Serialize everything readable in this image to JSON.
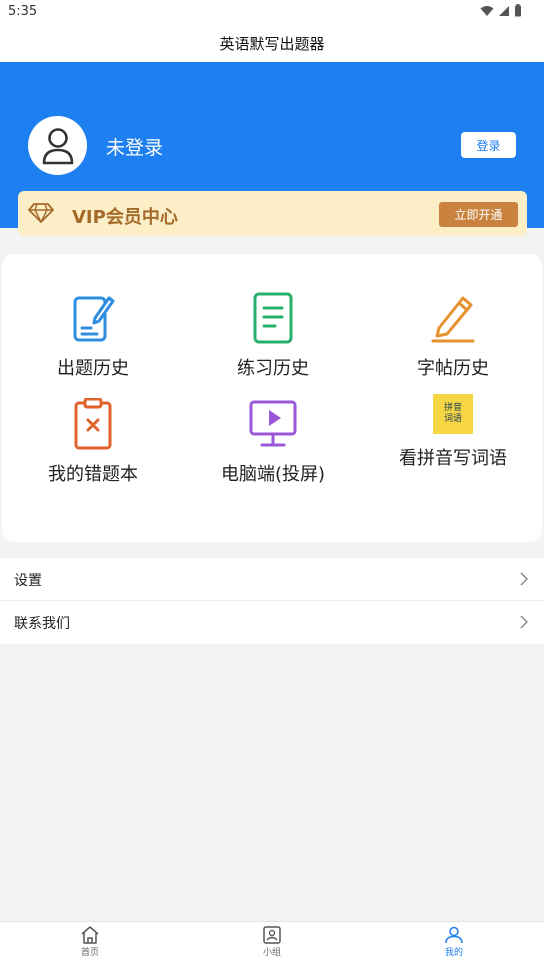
{
  "status_bar": {
    "time": "5:35"
  },
  "app": {
    "title": "英语默写出题器"
  },
  "profile": {
    "username": "未登录",
    "login_label": "登录"
  },
  "vip": {
    "title": "VIP会员中心",
    "button_label": "立即开通"
  },
  "features": [
    {
      "label": "出题历史",
      "icon": "document-edit-icon",
      "color": "#2f8de0"
    },
    {
      "label": "练习历史",
      "icon": "document-list-icon",
      "color": "#26b06b"
    },
    {
      "label": "字帖历史",
      "icon": "pencil-icon",
      "color": "#e6922e"
    },
    {
      "label": "我的错题本",
      "icon": "clipboard-x-icon",
      "color": "#e0622c"
    },
    {
      "label": "电脑端(投屏)",
      "icon": "monitor-play-icon",
      "color": "#9a57d8"
    },
    {
      "label": "看拼音写词语",
      "icon": "pinyin-badge-icon",
      "badge_line1": "拼音",
      "badge_line2": "词语",
      "color": "#f7d645"
    }
  ],
  "menu": [
    {
      "label": "设置"
    },
    {
      "label": "联系我们"
    }
  ],
  "tabs": [
    {
      "label": "首页",
      "icon": "home-icon",
      "active": false
    },
    {
      "label": "小组",
      "icon": "group-icon",
      "active": false
    },
    {
      "label": "我的",
      "icon": "profile-icon",
      "active": true
    }
  ],
  "colors": {
    "primary": "#1e7ff0",
    "vip_bg": "#fcefc7",
    "vip_text": "#a46a2a",
    "vip_button": "#c9833f"
  }
}
